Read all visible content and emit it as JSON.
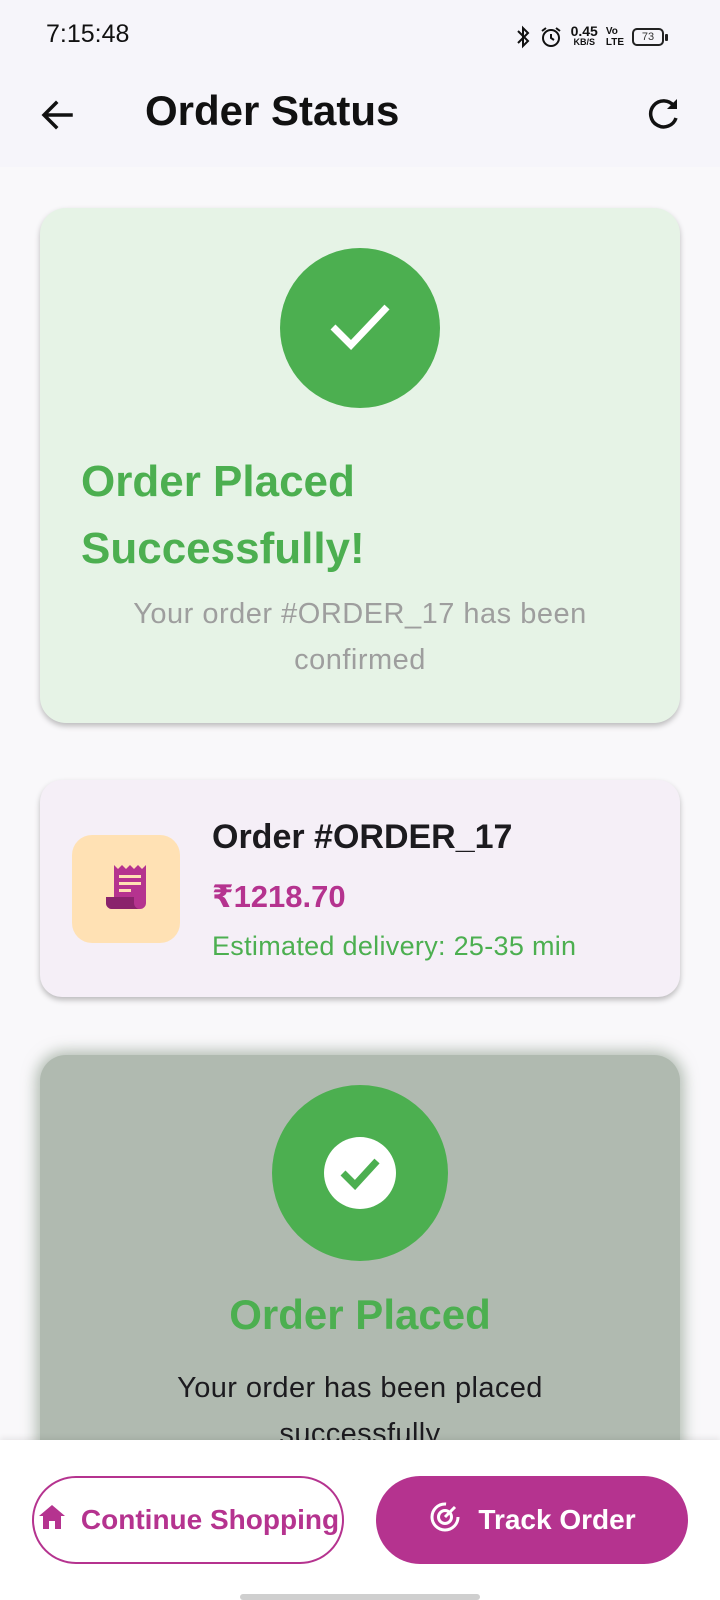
{
  "status_bar": {
    "time": "7:15:48",
    "net_speed_value": "0.45",
    "net_speed_unit": "KB/S",
    "volte_top": "Vo",
    "volte_bottom": "LTE",
    "battery": "73",
    "icons": [
      "bluetooth-icon",
      "alarm-icon",
      "volte-icon",
      "battery-icon"
    ]
  },
  "app_bar": {
    "title": "Order Status",
    "back_icon": "arrow-back-icon",
    "refresh_icon": "refresh-icon"
  },
  "success_card": {
    "icon": "check-icon",
    "title": "Order Placed Successfully!",
    "subtitle": "Your order #ORDER_17 has been confirmed",
    "colors": {
      "background": "#e6f3e6",
      "accent": "#4caf50"
    }
  },
  "order_card": {
    "icon": "receipt-icon",
    "order_number": "Order #ORDER_17",
    "price": "₹1218.70",
    "estimated_delivery": "Estimated delivery: 25-35 min",
    "colors": {
      "price": "#b5338f",
      "icon_bg": "#ffe1b4"
    }
  },
  "status_step": {
    "icon": "check-circle-icon",
    "title": "Order Placed",
    "description": "Your order has been placed successfully"
  },
  "bottom_bar": {
    "continue_label": "Continue Shopping",
    "continue_icon": "home-icon",
    "track_label": "Track Order",
    "track_icon": "track-icon",
    "colors": {
      "primary": "#b5338f"
    }
  }
}
